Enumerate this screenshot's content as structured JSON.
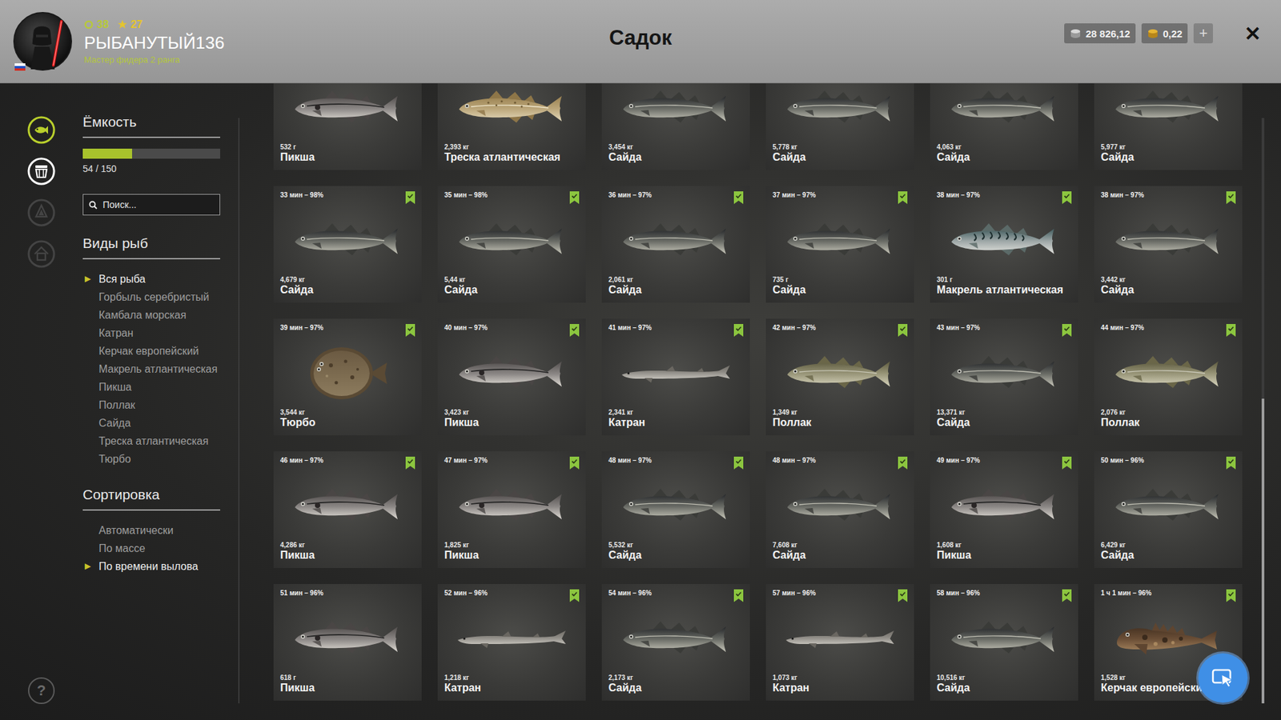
{
  "header": {
    "title": "Садок",
    "player": {
      "name": "РЫБАНУТЫЙ136",
      "rank": "Мастер фидера 2 ранга",
      "level": "38",
      "stars": "27"
    },
    "currency": [
      {
        "value": "28 826,12",
        "kind": "silver"
      },
      {
        "value": "0,22",
        "kind": "gold"
      }
    ],
    "add_button": "+",
    "close_button": "✕"
  },
  "nav": [
    {
      "kind": "fish",
      "color": "#b9cf2c",
      "disabled": false
    },
    {
      "kind": "keepnet",
      "color": "#ffffff",
      "disabled": false
    },
    {
      "kind": "boat",
      "color": "#4a4a4a",
      "disabled": true
    },
    {
      "kind": "home",
      "color": "#4a4a4a",
      "disabled": true
    }
  ],
  "help": "?",
  "capacity": {
    "title": "Ёмкость",
    "level": 0.36,
    "reading": "54 / 150"
  },
  "search": {
    "placeholder": "Поиск..."
  },
  "selected_marker": "▶",
  "species": {
    "title": "Виды рыб",
    "items": [
      {
        "label": "Вся рыба",
        "selected": true
      },
      {
        "label": "Горбыль серебристый",
        "selected": false
      },
      {
        "label": "Камбала морская",
        "selected": false
      },
      {
        "label": "Катран",
        "selected": false
      },
      {
        "label": "Керчак европейский",
        "selected": false
      },
      {
        "label": "Макрель атлантическая",
        "selected": false
      },
      {
        "label": "Пикша",
        "selected": false
      },
      {
        "label": "Поллак",
        "selected": false
      },
      {
        "label": "Сайда",
        "selected": false
      },
      {
        "label": "Треска атлантическая",
        "selected": false
      },
      {
        "label": "Тюрбо",
        "selected": false
      }
    ]
  },
  "sort": {
    "title": "Сортировка",
    "items": [
      {
        "label": "Автоматически",
        "selected": false
      },
      {
        "label": "По массе",
        "selected": false
      },
      {
        "label": "По времени вылова",
        "selected": true
      }
    ]
  },
  "catches": [
    [
      {
        "weight": "532 г",
        "name": "Пикша",
        "kind": "haddock"
      },
      {
        "weight": "2,393 кг",
        "name": "Треска атлантическая",
        "kind": "cod"
      },
      {
        "weight": "3,454 кг",
        "name": "Сайда",
        "kind": "saithe"
      },
      {
        "weight": "5,778 кг",
        "name": "Сайда",
        "kind": "saithe"
      },
      {
        "weight": "4,063 кг",
        "name": "Сайда",
        "kind": "saithe"
      },
      {
        "weight": "5,977 кг",
        "name": "Сайда",
        "kind": "saithe"
      }
    ],
    [
      {
        "time": "33 мин – 98%",
        "marked": true,
        "weight": "4,679 кг",
        "name": "Сайда",
        "kind": "saithe"
      },
      {
        "time": "35 мин – 98%",
        "marked": true,
        "weight": "5,44 кг",
        "name": "Сайда",
        "kind": "saithe"
      },
      {
        "time": "36 мин – 97%",
        "marked": true,
        "weight": "2,061 кг",
        "name": "Сайда",
        "kind": "saithe"
      },
      {
        "time": "37 мин – 97%",
        "marked": true,
        "weight": "735 г",
        "name": "Сайда",
        "kind": "saithe"
      },
      {
        "time": "38 мин – 97%",
        "marked": true,
        "weight": "301 г",
        "name": "Макрель атлантическая",
        "kind": "mackerel"
      },
      {
        "time": "38 мин – 97%",
        "marked": true,
        "weight": "3,442 кг",
        "name": "Сайда",
        "kind": "saithe"
      }
    ],
    [
      {
        "time": "39 мин – 97%",
        "marked": true,
        "weight": "3,544 кг",
        "name": "Тюрбо",
        "kind": "turbot"
      },
      {
        "time": "40 мин – 97%",
        "marked": true,
        "weight": "3,423 кг",
        "name": "Пикша",
        "kind": "haddock"
      },
      {
        "time": "41 мин – 97%",
        "marked": true,
        "weight": "2,341 кг",
        "name": "Катран",
        "kind": "dogfish"
      },
      {
        "time": "42 мин – 97%",
        "marked": true,
        "weight": "1,349 кг",
        "name": "Поллак",
        "kind": "pollack"
      },
      {
        "time": "43 мин – 97%",
        "marked": true,
        "weight": "13,371 кг",
        "name": "Сайда",
        "kind": "saithe"
      },
      {
        "time": "44 мин – 97%",
        "marked": true,
        "weight": "2,076 кг",
        "name": "Поллак",
        "kind": "pollack"
      }
    ],
    [
      {
        "time": "46 мин – 97%",
        "marked": true,
        "weight": "4,286 кг",
        "name": "Пикша",
        "kind": "haddock"
      },
      {
        "time": "47 мин – 97%",
        "marked": true,
        "weight": "1,825 кг",
        "name": "Пикша",
        "kind": "haddock"
      },
      {
        "time": "48 мин – 97%",
        "marked": true,
        "weight": "5,532 кг",
        "name": "Сайда",
        "kind": "saithe"
      },
      {
        "time": "48 мин – 97%",
        "marked": true,
        "weight": "7,608 кг",
        "name": "Сайда",
        "kind": "saithe"
      },
      {
        "time": "49 мин – 97%",
        "marked": true,
        "weight": "1,608 кг",
        "name": "Пикша",
        "kind": "haddock"
      },
      {
        "time": "50 мин – 96%",
        "marked": true,
        "weight": "6,429 кг",
        "name": "Сайда",
        "kind": "saithe"
      }
    ],
    [
      {
        "time": "51 мин – 96%",
        "marked": false,
        "weight": "618 г",
        "name": "Пикша",
        "kind": "haddock"
      },
      {
        "time": "52 мин – 96%",
        "marked": true,
        "weight": "1,218 кг",
        "name": "Катран",
        "kind": "dogfish"
      },
      {
        "time": "54 мин – 96%",
        "marked": true,
        "weight": "2,173 кг",
        "name": "Сайда",
        "kind": "saithe"
      },
      {
        "time": "57 мин – 96%",
        "marked": true,
        "weight": "1,073 кг",
        "name": "Катран",
        "kind": "dogfish"
      },
      {
        "time": "58 мин – 96%",
        "marked": true,
        "weight": "10,516 кг",
        "name": "Сайда",
        "kind": "saithe"
      },
      {
        "time": "1 ч 1 мин – 96%",
        "marked": true,
        "weight": "1,528 кг",
        "name": "Керчак европейски",
        "kind": "sculpin"
      }
    ]
  ],
  "scrollbar": {
    "level": 0.52
  }
}
